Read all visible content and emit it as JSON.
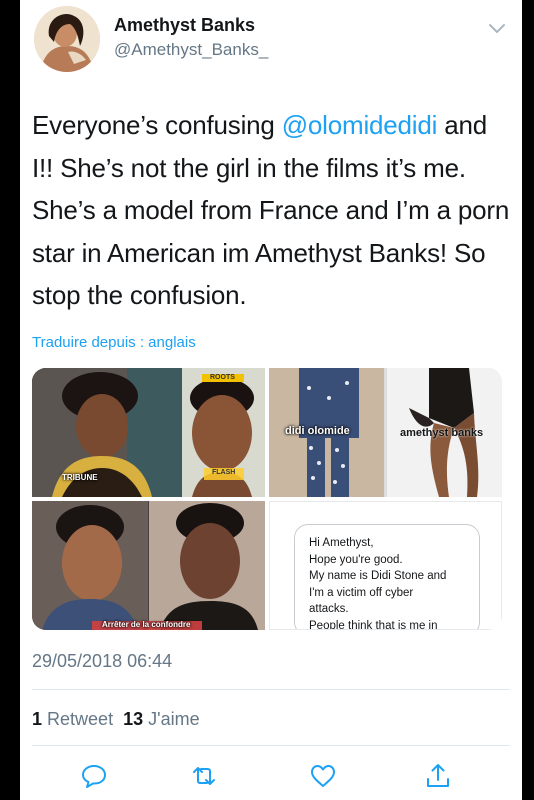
{
  "user": {
    "display_name": "Amethyst Banks",
    "handle": "@Amethyst_Banks_"
  },
  "tweet": {
    "text_before": "Everyone’s confusing ",
    "mention": "@olomidedidi",
    "text_after": " and I!! She’s not the girl in the films it’s me. She’s a model from France and I’m a porn star in American im Amethyst Banks! So stop the confusion.",
    "translate_link": "Traduire depuis : anglais",
    "timestamp": "29/05/2018 06:44"
  },
  "media": {
    "tl_caption": "TRIBUNE",
    "tl_badge": "ROOTS",
    "tl_badge2": "FLASH",
    "tr_left_label": "didi olomide",
    "tr_right_label": "amethyst banks",
    "bl_caption": "Arrêter de la confondre",
    "message_lines": [
      "Hi Amethyst,",
      "Hope you're good.",
      "My name is Didi Stone and",
      "I'm a victim off cyber",
      "attacks.",
      "People think that is me in"
    ]
  },
  "stats": {
    "retweets_count": "1",
    "retweets_label": "Retweet",
    "likes_count": "13",
    "likes_label": "J'aime"
  },
  "actions": {
    "reply_icon": "reply-icon",
    "retweet_icon": "retweet-icon",
    "like_icon": "heart-icon",
    "share_icon": "share-icon"
  },
  "colors": {
    "link": "#1da1f2",
    "text": "#14171a",
    "muted": "#657786",
    "action": "#1da1f2"
  }
}
